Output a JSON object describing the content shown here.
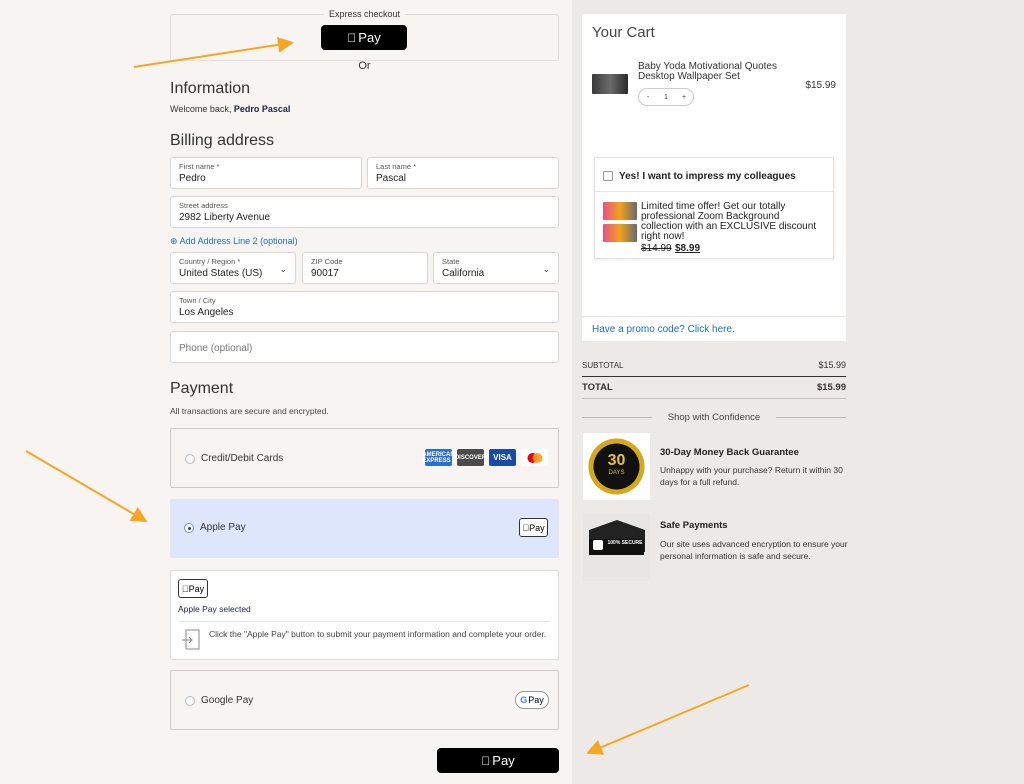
{
  "express": {
    "label": "Express checkout",
    "button_label": "Pay",
    "or": "Or"
  },
  "information": {
    "title": "Information",
    "welcome_prefix": "Welcome back, ",
    "user_name": "Pedro Pascal"
  },
  "billing": {
    "title": "Billing address",
    "first_name": {
      "label": "First name *",
      "value": "Pedro"
    },
    "last_name": {
      "label": "Last name *",
      "value": "Pascal"
    },
    "street": {
      "label": "Street address",
      "value": "2982 Liberty Avenue"
    },
    "add_line": "Add Address Line 2 (optional)",
    "country": {
      "label": "Country / Region *",
      "value": "United States (US)"
    },
    "zip": {
      "label": "ZIP Code",
      "value": "90017"
    },
    "state": {
      "label": "State",
      "value": "California"
    },
    "city": {
      "label": "Town / City",
      "value": "Los Angeles"
    },
    "phone": {
      "placeholder": "Phone (optional)"
    }
  },
  "payment": {
    "title": "Payment",
    "subtitle": "All transactions are secure and encrypted.",
    "options": [
      {
        "label": "Credit/Debit Cards",
        "selected": false
      },
      {
        "label": "Apple Pay",
        "selected": true
      },
      {
        "label": "Google Pay",
        "selected": false
      }
    ],
    "cards": [
      "AMERICAN EXPRESS",
      "DISCOVER",
      "VISA",
      "mastercard"
    ],
    "apple_badge": "Pay",
    "google_badge": "Pay",
    "apple_selected": "Apple Pay selected",
    "apple_instructions": "Click the \"Apple Pay\" button to submit your payment information and complete your order.",
    "submit_label": "Pay"
  },
  "cart": {
    "title": "Your Cart",
    "item": {
      "name": "Baby Yoda Motivational Quotes Desktop Wallpaper Set",
      "price": "$15.99",
      "qty": "1",
      "minus": "-",
      "plus": "+"
    },
    "upsell": {
      "title": "Yes! I want to impress my colleagues",
      "desc": "Limited time offer! Get our totally professional Zoom Background collection with an EXCLUSIVE discount right now!",
      "old_price": "$14.99",
      "new_price": "$8.99"
    },
    "promo": "Have a promo code? Click here."
  },
  "summary": {
    "subtotal_label": "SUBTOTAL",
    "subtotal": "$15.99",
    "total_label": "TOTAL",
    "total": "$15.99"
  },
  "confidence": {
    "title": "Shop with Confidence",
    "guarantee": {
      "badge_text": "30",
      "badge_sub": "DAYS",
      "title": "30-Day Money Back Guarantee",
      "desc": "Unhappy with your purchase? Return it within 30 days for a full refund."
    },
    "safe": {
      "badge_text": "100% SECURE",
      "title": "Safe Payments",
      "desc": "Our site uses advanced encryption to ensure your personal information is safe and secure."
    }
  },
  "colors": {
    "accent_blue": "#1f6fb2",
    "selected_bg": "#dde6fa",
    "arrow": "#f5a623"
  }
}
